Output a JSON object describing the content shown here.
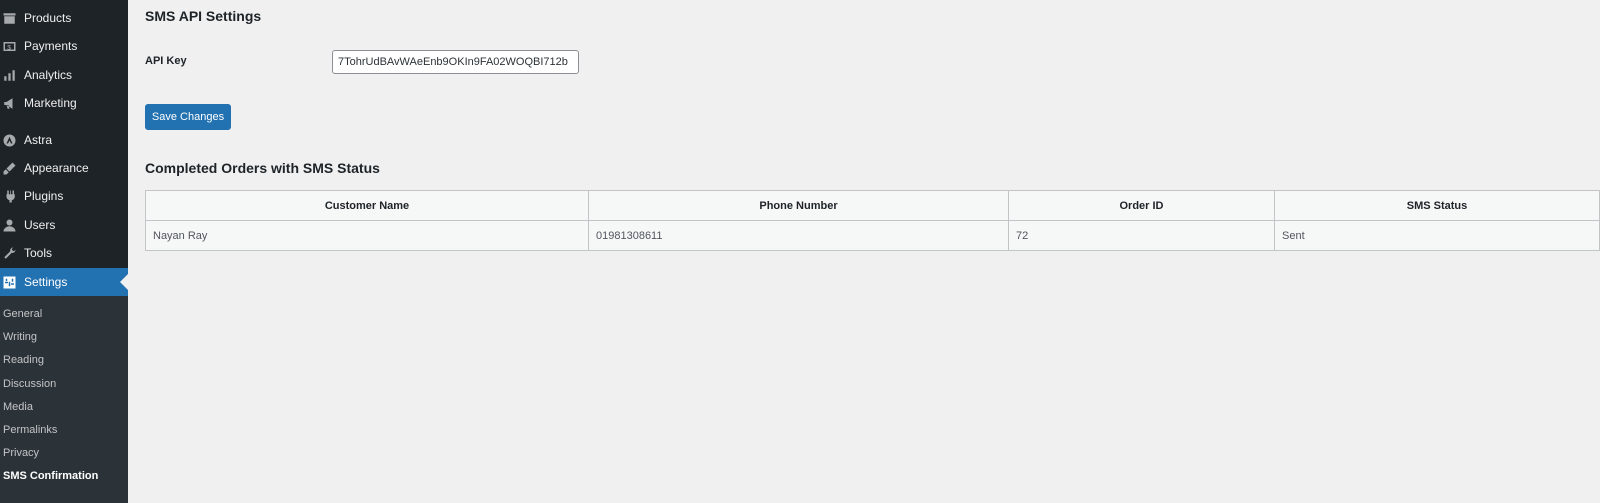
{
  "sidebar": {
    "items": [
      {
        "label": "Products",
        "icon": "products-icon"
      },
      {
        "label": "Payments",
        "icon": "payments-icon"
      },
      {
        "label": "Analytics",
        "icon": "analytics-icon"
      },
      {
        "label": "Marketing",
        "icon": "marketing-icon"
      },
      {
        "label": "Astra",
        "icon": "astra-icon"
      },
      {
        "label": "Appearance",
        "icon": "appearance-icon"
      },
      {
        "label": "Plugins",
        "icon": "plugins-icon"
      },
      {
        "label": "Users",
        "icon": "users-icon"
      },
      {
        "label": "Tools",
        "icon": "tools-icon"
      },
      {
        "label": "Settings",
        "icon": "settings-icon",
        "active": true
      }
    ],
    "submenu": [
      {
        "label": "General"
      },
      {
        "label": "Writing"
      },
      {
        "label": "Reading"
      },
      {
        "label": "Discussion"
      },
      {
        "label": "Media"
      },
      {
        "label": "Permalinks"
      },
      {
        "label": "Privacy"
      },
      {
        "label": "SMS Confirmation",
        "current": true
      }
    ]
  },
  "main": {
    "title": "SMS API Settings",
    "api_key_label": "API Key",
    "api_key_value": "7TohrUdBAvWAeEnb9OKIn9FA02WOQBI712b",
    "save_label": "Save Changes",
    "orders_title": "Completed Orders with SMS Status",
    "table": {
      "headers": [
        "Customer Name",
        "Phone Number",
        "Order ID",
        "SMS Status"
      ],
      "rows": [
        [
          "Nayan Ray",
          "01981308611",
          "72",
          "Sent"
        ]
      ]
    }
  },
  "colors": {
    "accent": "#2271b1",
    "sidebar_bg": "#1d2327",
    "submenu_bg": "#2c3338",
    "page_bg": "#f0f0f1"
  }
}
